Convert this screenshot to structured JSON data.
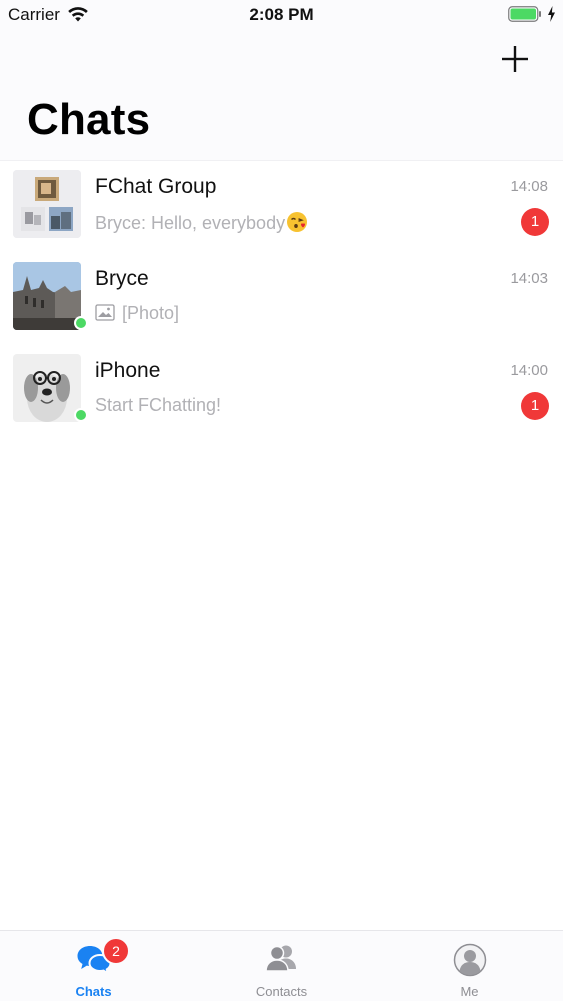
{
  "status_bar": {
    "carrier": "Carrier",
    "time": "2:08 PM",
    "battery_color": "#4cd964"
  },
  "header": {
    "title": "Chats",
    "add_icon": "plus-icon"
  },
  "chats": [
    {
      "name": "FChat Group",
      "time": "14:08",
      "preview": "Bryce: Hello, everybody",
      "preview_emoji": "kissing-face-emoji",
      "unread": "1",
      "online": false,
      "avatar": "group-collage-avatar"
    },
    {
      "name": "Bryce",
      "time": "14:03",
      "preview": "[Photo]",
      "preview_icon": "image-icon",
      "unread": "",
      "online": true,
      "avatar": "cathedral-photo-avatar"
    },
    {
      "name": "iPhone",
      "time": "14:00",
      "preview": "Start FChatting!",
      "unread": "1",
      "online": true,
      "avatar": "dog-photo-avatar"
    }
  ],
  "tab_bar": {
    "tabs": [
      {
        "label": "Chats",
        "icon": "chat-bubbles-icon",
        "badge": "2",
        "active": true
      },
      {
        "label": "Contacts",
        "icon": "contacts-icon",
        "badge": "",
        "active": false
      },
      {
        "label": "Me",
        "icon": "profile-icon",
        "badge": "",
        "active": false
      }
    ]
  },
  "colors": {
    "accent": "#1a82f2",
    "badge": "#f03838",
    "online": "#4cd964",
    "secondary_text": "#b1b1b5"
  }
}
